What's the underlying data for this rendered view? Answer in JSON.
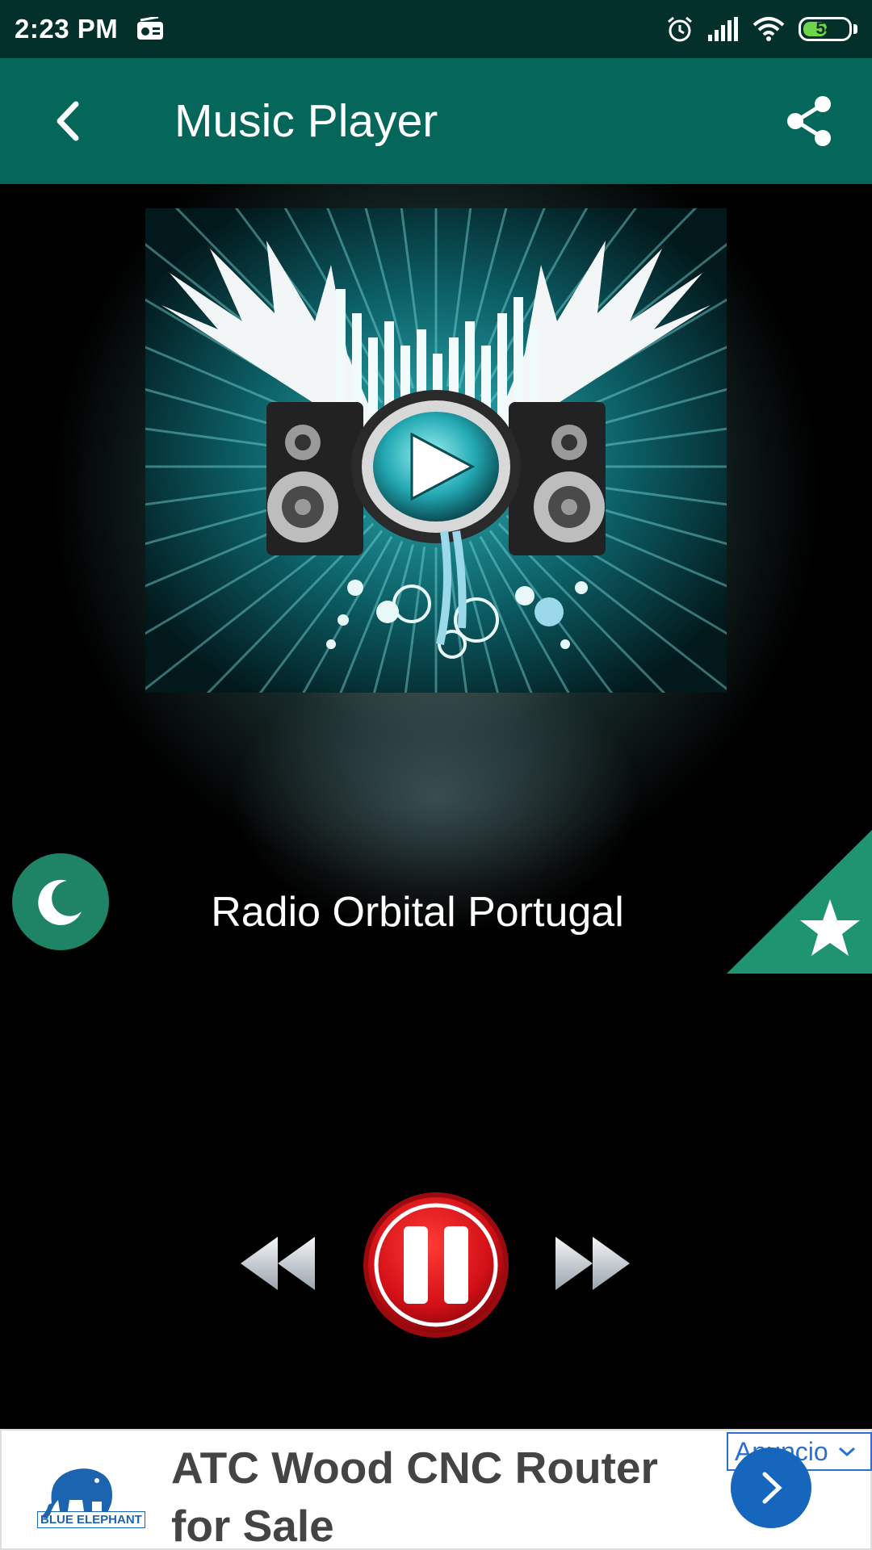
{
  "status_bar": {
    "time": "2:23 PM",
    "battery_level": "54",
    "battery_fraction": 0.54,
    "icons": [
      "radio-icon",
      "alarm-icon",
      "signal-icon",
      "wifi-icon",
      "battery-icon"
    ]
  },
  "app_bar": {
    "title": "Music Player",
    "back_icon": "back-arrow-icon",
    "share_icon": "share-icon"
  },
  "player": {
    "station_name": "Radio Orbital Portugal",
    "sleep_icon": "moon-icon",
    "favorite_icon": "star-icon",
    "state": "playing"
  },
  "controls": {
    "previous_icon": "rewind-icon",
    "pause_icon": "pause-icon",
    "next_icon": "fast-forward-icon"
  },
  "ad": {
    "title": "ATC Wood CNC Router for Sale",
    "brand": "BLUE ELEPHANT",
    "badge": "Anuncio",
    "arrow_icon": "chevron-right-icon"
  },
  "colors": {
    "status_bar": "#04302b",
    "app_bar": "#05675a",
    "accent_green": "#1f8466",
    "pause_red": "#e0141b",
    "ad_blue": "#1666be"
  }
}
